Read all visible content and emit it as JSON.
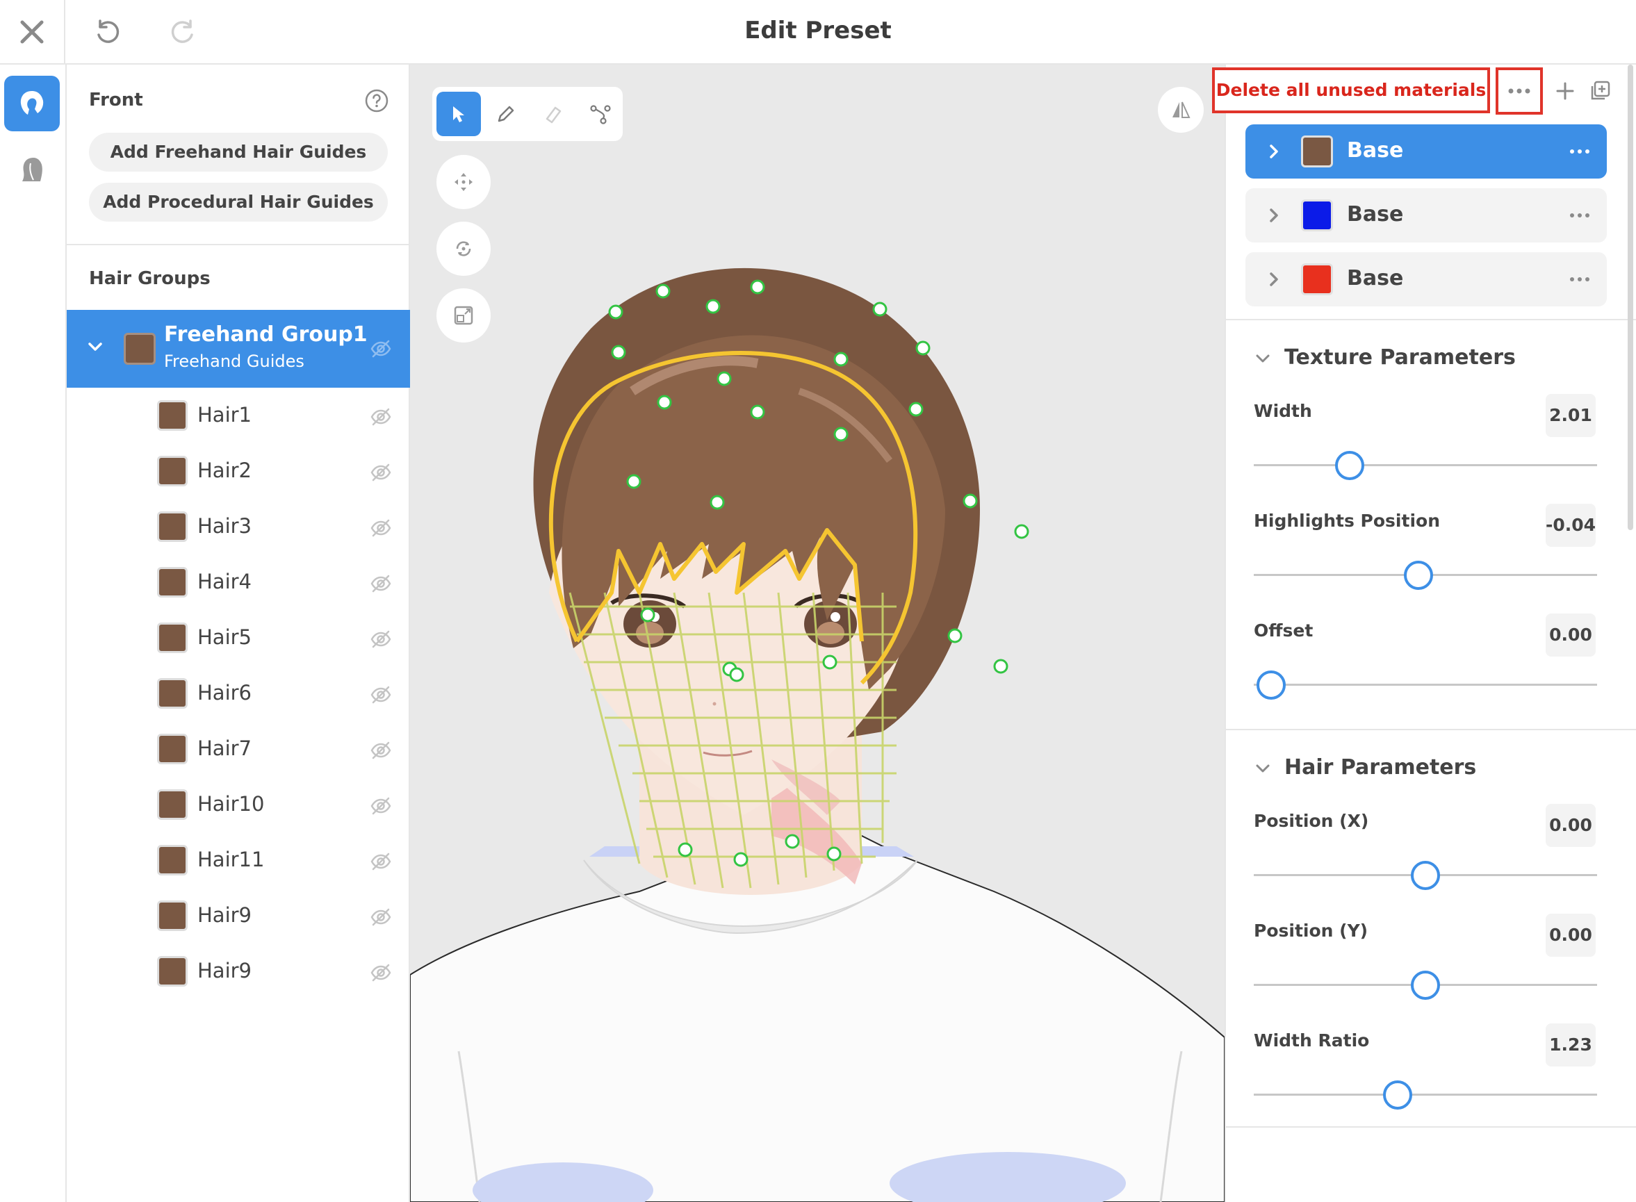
{
  "window": {
    "title": "Edit Preset"
  },
  "left_panel": {
    "section_title": "Front",
    "add_freehand_label": "Add Freehand Hair Guides",
    "add_procedural_label": "Add Procedural Hair Guides",
    "hair_groups_title": "Hair Groups",
    "group": {
      "name": "Freehand Group1",
      "subtitle": "Freehand Guides",
      "color": "#7a5843"
    },
    "items": [
      {
        "name": "Hair1"
      },
      {
        "name": "Hair2"
      },
      {
        "name": "Hair3"
      },
      {
        "name": "Hair4"
      },
      {
        "name": "Hair5"
      },
      {
        "name": "Hair6"
      },
      {
        "name": "Hair7"
      },
      {
        "name": "Hair10"
      },
      {
        "name": "Hair11"
      },
      {
        "name": "Hair9"
      },
      {
        "name": "Hair9"
      }
    ]
  },
  "right_panel": {
    "tooltip": "Delete all unused materials",
    "materials": [
      {
        "label": "Base",
        "color": "#7a5843"
      },
      {
        "label": "Base",
        "color": "#0b1be8"
      },
      {
        "label": "Base",
        "color": "#e8301e"
      }
    ],
    "texture_section": {
      "title": "Texture Parameters",
      "params": [
        {
          "label": "Width",
          "value": "2.01",
          "fraction": 0.28
        },
        {
          "label": "Highlights Position",
          "value": "-0.04",
          "fraction": 0.48
        },
        {
          "label": "Offset",
          "value": "0.00",
          "fraction": 0.05
        }
      ]
    },
    "hair_section": {
      "title": "Hair Parameters",
      "params": [
        {
          "label": "Position (X)",
          "value": "0.00",
          "fraction": 0.5
        },
        {
          "label": "Position (Y)",
          "value": "0.00",
          "fraction": 0.5
        },
        {
          "label": "Width Ratio",
          "value": "1.23",
          "fraction": 0.42
        }
      ]
    }
  },
  "colors": {
    "accent": "#3d8fe6",
    "highlight": "#e0342a",
    "hair_guide": "#f5c531"
  }
}
